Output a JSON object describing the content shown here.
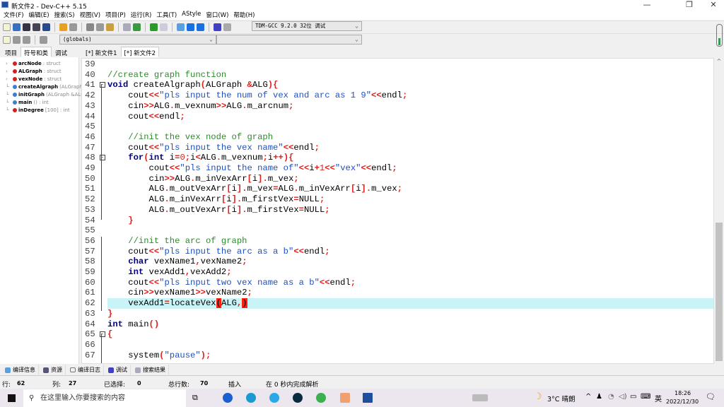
{
  "window": {
    "title": "新文件2 - Dev-C++ 5.15",
    "minimize": "—",
    "maximize": "❐",
    "close": "✕"
  },
  "menu": [
    "文件(F)",
    "编辑(E)",
    "搜索(S)",
    "视图(V)",
    "项目(P)",
    "运行(R)",
    "工具(T)",
    "AStyle",
    "窗口(W)",
    "帮助(H)"
  ],
  "toolbar": {
    "compiler": "TDM-GCC 9.2.0 32位 调试",
    "scope": "(globals)",
    "function": ""
  },
  "left_tabs": [
    "项目",
    "符号和类",
    "调试"
  ],
  "editor_tabs": [
    "[*] 新文件1",
    "[*] 新文件2"
  ],
  "symbols": [
    {
      "name": "arcNode",
      "type": ": struct",
      "color": "#d02020"
    },
    {
      "name": "ALGraph",
      "type": ": struct",
      "color": "#d02020"
    },
    {
      "name": "vexNode",
      "type": ": struct",
      "color": "#d02020"
    },
    {
      "name": "createAlgraph",
      "type": "(ALGraph",
      "color": "#3a7fd0"
    },
    {
      "name": "initGraph",
      "type": "(ALGraph &ALG",
      "color": "#3a7fd0"
    },
    {
      "name": "main",
      "type": "() : int",
      "color": "#3a7fd0"
    },
    {
      "name": "inDegree",
      "type": "[100] : int",
      "color": "#d02020"
    }
  ],
  "code": {
    "first_line": 39,
    "current_line": 62,
    "lines": [
      [],
      [
        [
          "cm",
          "//create graph function"
        ]
      ],
      [
        [
          "kw",
          "void"
        ],
        [
          "id",
          " createAlgraph"
        ],
        [
          "op",
          "("
        ],
        [
          "id",
          "ALGraph "
        ],
        [
          "op",
          "&"
        ],
        [
          "id",
          "ALG"
        ],
        [
          "op",
          "){"
        ]
      ],
      [
        [
          "id",
          "    cout"
        ],
        [
          "op",
          "<<"
        ],
        [
          "str",
          "\"pls input the num of vex and arc as 1 9\""
        ],
        [
          "op",
          "<<"
        ],
        [
          "id",
          "endl"
        ],
        [
          "op",
          ";"
        ]
      ],
      [
        [
          "id",
          "    cin"
        ],
        [
          "op",
          ">>"
        ],
        [
          "id",
          "ALG"
        ],
        [
          "op",
          "."
        ],
        [
          "id",
          "m_vexnum"
        ],
        [
          "op",
          ">>"
        ],
        [
          "id",
          "ALG"
        ],
        [
          "op",
          "."
        ],
        [
          "id",
          "m_arcnum"
        ],
        [
          "op",
          ";"
        ]
      ],
      [
        [
          "id",
          "    cout"
        ],
        [
          "op",
          "<<"
        ],
        [
          "id",
          "endl"
        ],
        [
          "op",
          ";"
        ]
      ],
      [],
      [
        [
          "cm",
          "    //init the vex node of graph"
        ]
      ],
      [
        [
          "id",
          "    cout"
        ],
        [
          "op",
          "<<"
        ],
        [
          "str",
          "\"pls input the vex name\""
        ],
        [
          "op",
          "<<"
        ],
        [
          "id",
          "endl"
        ],
        [
          "op",
          ";"
        ]
      ],
      [
        [
          "kw",
          "    for"
        ],
        [
          "op",
          "("
        ],
        [
          "kw",
          "int"
        ],
        [
          "id",
          " i"
        ],
        [
          "op",
          "="
        ],
        [
          "num",
          "0"
        ],
        [
          "op",
          ";"
        ],
        [
          "id",
          "i"
        ],
        [
          "op",
          "<"
        ],
        [
          "id",
          "ALG"
        ],
        [
          "op",
          "."
        ],
        [
          "id",
          "m_vexnum"
        ],
        [
          "op",
          ";"
        ],
        [
          "id",
          "i"
        ],
        [
          "op",
          "++){"
        ]
      ],
      [
        [
          "id",
          "        cout"
        ],
        [
          "op",
          "<<"
        ],
        [
          "str",
          "\"pls input the name of\""
        ],
        [
          "op",
          "<<"
        ],
        [
          "id",
          "i"
        ],
        [
          "op",
          "+"
        ],
        [
          "num",
          "1"
        ],
        [
          "op",
          "<<"
        ],
        [
          "str",
          "\"vex\""
        ],
        [
          "op",
          "<<"
        ],
        [
          "id",
          "endl"
        ],
        [
          "op",
          ";"
        ]
      ],
      [
        [
          "id",
          "        cin"
        ],
        [
          "op",
          ">>"
        ],
        [
          "id",
          "ALG"
        ],
        [
          "op",
          "."
        ],
        [
          "id",
          "m_inVexArr"
        ],
        [
          "op",
          "["
        ],
        [
          "id",
          "i"
        ],
        [
          "op",
          "]."
        ],
        [
          "id",
          "m_vex"
        ],
        [
          "op",
          ";"
        ]
      ],
      [
        [
          "id",
          "        ALG"
        ],
        [
          "op",
          "."
        ],
        [
          "id",
          "m_outVexArr"
        ],
        [
          "op",
          "["
        ],
        [
          "id",
          "i"
        ],
        [
          "op",
          "]."
        ],
        [
          "id",
          "m_vex"
        ],
        [
          "op",
          "="
        ],
        [
          "id",
          "ALG"
        ],
        [
          "op",
          "."
        ],
        [
          "id",
          "m_inVexArr"
        ],
        [
          "op",
          "["
        ],
        [
          "id",
          "i"
        ],
        [
          "op",
          "]."
        ],
        [
          "id",
          "m_vex"
        ],
        [
          "op",
          ";"
        ]
      ],
      [
        [
          "id",
          "        ALG"
        ],
        [
          "op",
          "."
        ],
        [
          "id",
          "m_inVexArr"
        ],
        [
          "op",
          "["
        ],
        [
          "id",
          "i"
        ],
        [
          "op",
          "]."
        ],
        [
          "id",
          "m_firstVex"
        ],
        [
          "op",
          "="
        ],
        [
          "id",
          "NULL"
        ],
        [
          "op",
          ";"
        ]
      ],
      [
        [
          "id",
          "        ALG"
        ],
        [
          "op",
          "."
        ],
        [
          "id",
          "m_outVexArr"
        ],
        [
          "op",
          "["
        ],
        [
          "id",
          "i"
        ],
        [
          "op",
          "]."
        ],
        [
          "id",
          "m_firstVex"
        ],
        [
          "op",
          "="
        ],
        [
          "id",
          "NULL"
        ],
        [
          "op",
          ";"
        ]
      ],
      [
        [
          "op",
          "    }"
        ]
      ],
      [],
      [
        [
          "cm",
          "    //init the arc of graph"
        ]
      ],
      [
        [
          "id",
          "    cout"
        ],
        [
          "op",
          "<<"
        ],
        [
          "str",
          "\"pls input the arc as a b\""
        ],
        [
          "op",
          "<<"
        ],
        [
          "id",
          "endl"
        ],
        [
          "op",
          ";"
        ]
      ],
      [
        [
          "kw",
          "    char"
        ],
        [
          "id",
          " vexName1"
        ],
        [
          "op",
          ","
        ],
        [
          "id",
          "vexName2"
        ],
        [
          "op",
          ";"
        ]
      ],
      [
        [
          "kw",
          "    int"
        ],
        [
          "id",
          " vexAdd1"
        ],
        [
          "op",
          ","
        ],
        [
          "id",
          "vexAdd2"
        ],
        [
          "op",
          ";"
        ]
      ],
      [
        [
          "id",
          "    cout"
        ],
        [
          "op",
          "<<"
        ],
        [
          "str",
          "\"pls input two vex name as a b\""
        ],
        [
          "op",
          "<<"
        ],
        [
          "id",
          "endl"
        ],
        [
          "op",
          ";"
        ]
      ],
      [
        [
          "id",
          "    cin"
        ],
        [
          "op",
          ">>"
        ],
        [
          "id",
          "vexName1"
        ],
        [
          "op",
          ">>"
        ],
        [
          "id",
          "vexName2"
        ],
        [
          "op",
          ";"
        ]
      ],
      [
        [
          "id",
          "    vexAdd1"
        ],
        [
          "op",
          "="
        ],
        [
          "id",
          "locateVex"
        ],
        [
          "br",
          "("
        ],
        [
          "id",
          "ALG"
        ],
        [
          "op",
          ","
        ],
        [
          "br",
          ")"
        ]
      ],
      [
        [
          "op",
          "}"
        ]
      ],
      [
        [
          "kw",
          "int"
        ],
        [
          "id",
          " main"
        ],
        [
          "op",
          "()"
        ]
      ],
      [
        [
          "op",
          "{"
        ]
      ],
      [],
      [
        [
          "id",
          "    system"
        ],
        [
          "op",
          "("
        ],
        [
          "str",
          "\"pause\""
        ],
        [
          "op",
          ");"
        ]
      ]
    ]
  },
  "bottom_tabs": [
    "编译信息",
    "资源",
    "编译日志",
    "调试",
    "搜索结果"
  ],
  "status": {
    "row_label": "行:",
    "row": "62",
    "col_label": "列:",
    "col": "27",
    "sel_label": "已选择:",
    "sel": "0",
    "total_label": "总行数:",
    "total": "70",
    "mode": "插入",
    "parse": "在 0 秒内完成解析"
  },
  "taskbar": {
    "search_placeholder": "在这里输入你要搜索的内容",
    "weather": "3°C 晴朗",
    "ime": "英",
    "time": "18:26",
    "date": "2022/12/30"
  }
}
